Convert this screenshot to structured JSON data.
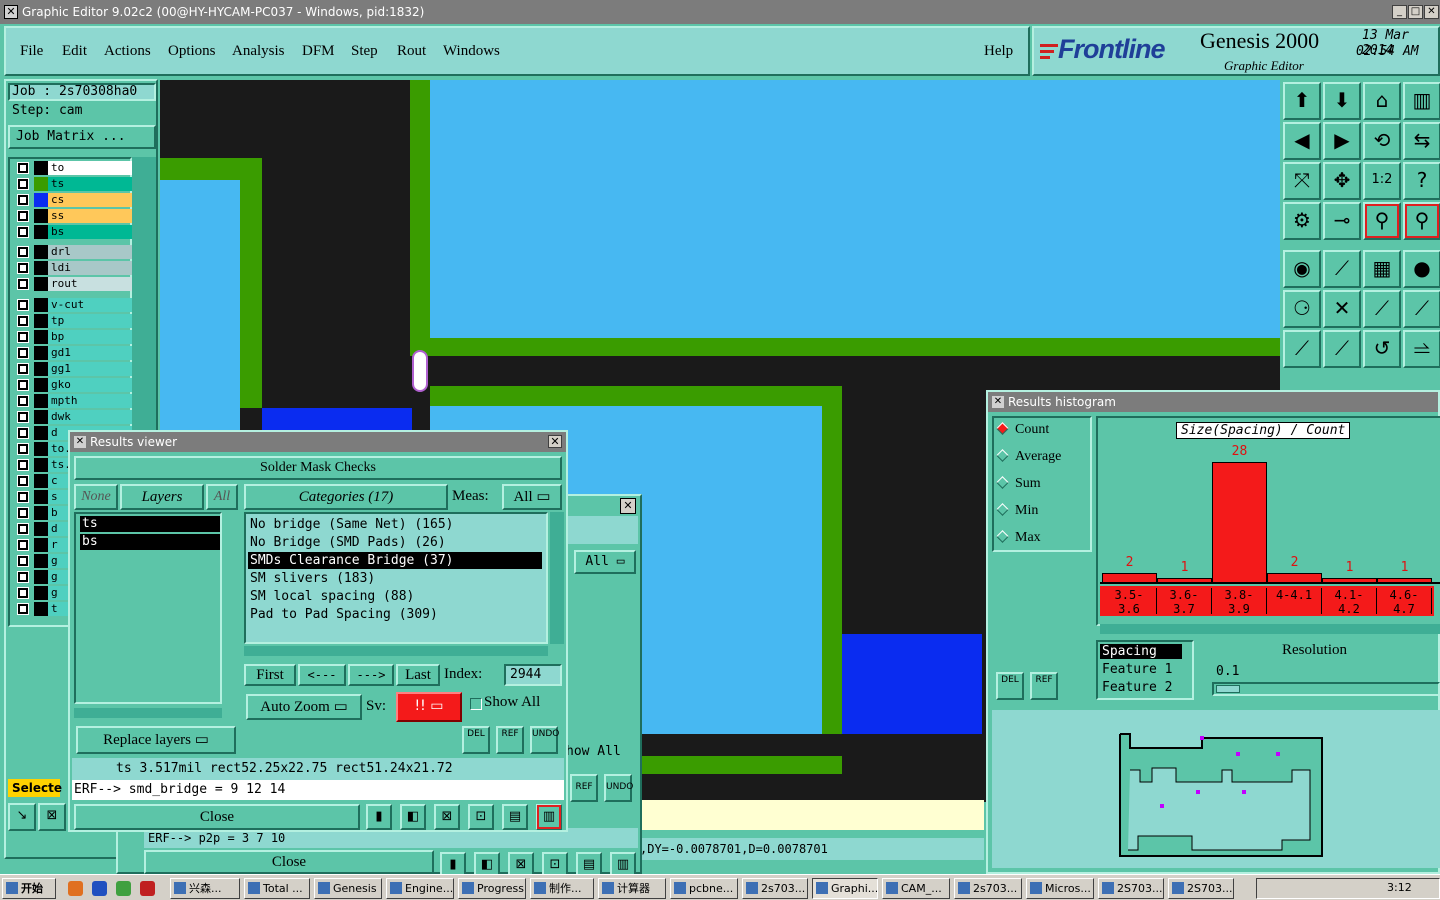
{
  "titlebar": {
    "title": "Graphic Editor 9.02c2 (00@HY-HYCAM-PC037 - Windows, pid:1832)"
  },
  "menu": {
    "items": [
      "File",
      "Edit",
      "Actions",
      "Options",
      "Analysis",
      "DFM",
      "Step",
      "Rout",
      "Windows"
    ],
    "help": "Help"
  },
  "logo": {
    "brand": "Frontline",
    "product": "Genesis 2000",
    "subtitle": "Graphic Editor",
    "date": "13 Mar 2014",
    "time": "02:54 AM"
  },
  "job": {
    "job": "Job : 2s70308ha0",
    "step": "Step: cam",
    "matrix_button": "Job Matrix ..."
  },
  "layers": [
    {
      "name": "to",
      "color": "#ffffff",
      "swatch": "#000000"
    },
    {
      "name": "ts",
      "color": "#00b894",
      "swatch": "#3a9c00"
    },
    {
      "name": "cs",
      "color": "#ffc85a",
      "swatch": "#0a2cf0"
    },
    {
      "name": "ss",
      "color": "#ffc85a",
      "swatch": "#000000"
    },
    {
      "name": "bs",
      "color": "#00b894",
      "swatch": "#000000"
    },
    {
      "name": "drl",
      "color": "#a8c8c8",
      "swatch": "#000000"
    },
    {
      "name": "ldi",
      "color": "#a8c8c8",
      "swatch": "#000000"
    },
    {
      "name": "rout",
      "color": "#c8e0e0",
      "swatch": "#000000"
    },
    {
      "name": "v-cut",
      "color": "#4fd0c0",
      "swatch": "#000000"
    },
    {
      "name": "tp",
      "color": "#4fd0c0",
      "swatch": "#000000"
    },
    {
      "name": "bp",
      "color": "#4fd0c0",
      "swatch": "#000000"
    },
    {
      "name": "gd1",
      "color": "#4fd0c0",
      "swatch": "#000000"
    },
    {
      "name": "gg1",
      "color": "#4fd0c0",
      "swatch": "#000000"
    },
    {
      "name": "gko",
      "color": "#4fd0c0",
      "swatch": "#000000"
    },
    {
      "name": "mpth",
      "color": "#4fd0c0",
      "swatch": "#000000"
    },
    {
      "name": "dwk",
      "color": "#4fd0c0",
      "swatch": "#000000"
    },
    {
      "name": "d",
      "color": "#4fd0c0",
      "swatch": "#000000"
    },
    {
      "name": "to.",
      "color": "#4fd0c0",
      "swatch": "#000000"
    },
    {
      "name": "ts.",
      "color": "#4fd0c0",
      "swatch": "#000000"
    },
    {
      "name": "c",
      "color": "#4fd0c0",
      "swatch": "#000000"
    },
    {
      "name": "s",
      "color": "#4fd0c0",
      "swatch": "#000000"
    },
    {
      "name": "b",
      "color": "#4fd0c0",
      "swatch": "#000000"
    },
    {
      "name": "d",
      "color": "#4fd0c0",
      "swatch": "#000000"
    },
    {
      "name": "r",
      "color": "#4fd0c0",
      "swatch": "#000000"
    },
    {
      "name": "g",
      "color": "#4fd0c0",
      "swatch": "#000000"
    },
    {
      "name": "g",
      "color": "#4fd0c0",
      "swatch": "#000000"
    },
    {
      "name": "g",
      "color": "#4fd0c0",
      "swatch": "#000000"
    },
    {
      "name": "t",
      "color": "#4fd0c0",
      "swatch": "#000000"
    }
  ],
  "left_bottom": {
    "select_label": "Selecte"
  },
  "viewer": {
    "title": "Results viewer",
    "header": "Solder Mask Checks",
    "none": "None",
    "layers": "Layers",
    "all": "All",
    "layer_items": [
      "ts",
      "bs"
    ],
    "categories_label": "Categories (17)",
    "meas_label": "Meas:",
    "meas_value": "All",
    "categories": [
      "No bridge (Same Net) (165)",
      "No Bridge (SMD Pads) (26)",
      "SMDs Clearance Bridge (37)",
      "SM slivers (183)",
      "SM local spacing (88)",
      "Pad to Pad Spacing (309)"
    ],
    "first": "First",
    "prev": "<---",
    "next": "--->",
    "last": "Last",
    "index_label": "Index:",
    "index_value": "2944",
    "auto_zoom": "Auto Zoom",
    "sv_label": "Sv:",
    "sv_value": "!!",
    "show_all": "Show All",
    "replace_layers": "Replace layers",
    "del": "DEL",
    "ref": "REF",
    "undo": "UNDO",
    "status": "ts 3.517mil  rect52.25x22.75  rect51.24x21.72",
    "erf": "ERF--> smd_bridge = 9 12 14",
    "close": "Close"
  },
  "back_window": {
    "all": "All",
    "show_all": "how All",
    "erf": "ERF--> p2p = 3 7 10",
    "close": "Close",
    "ref": "REF",
    "undo": "UNDO"
  },
  "coord_readout": ",DY=-0.0078701,D=0.0078701",
  "histogram": {
    "title": "Results histogram",
    "options": [
      "Count",
      "Average",
      "Sum",
      "Min",
      "Max"
    ],
    "selected_option": "Count",
    "chart_title": "Size(Spacing) / Count",
    "del": "DEL",
    "ref": "REF",
    "list": [
      "Spacing",
      "Feature 1",
      "Feature 2"
    ],
    "resolution_label": "Resolution",
    "resolution_value": "0.1"
  },
  "chart_data": {
    "type": "bar",
    "title": "Size(Spacing) / Count",
    "categories": [
      "3.5-3.6",
      "3.6-3.7",
      "3.8-3.9",
      "4-4.1",
      "4.1-4.2",
      "4.6-4.7"
    ],
    "values": [
      2,
      1,
      28,
      2,
      1,
      1
    ],
    "color": "#f41a1a"
  },
  "taskbar": {
    "start": "开始",
    "clock": "3:12",
    "items": [
      "兴森...",
      "Total ...",
      "Genesis",
      "Engine...",
      "Progress",
      "制作...",
      "计算器",
      "pcbne...",
      "2s703...",
      "Graphi...",
      "CAM_...",
      "2s703...",
      "Micros...",
      "2S703...",
      "2S703..."
    ]
  }
}
